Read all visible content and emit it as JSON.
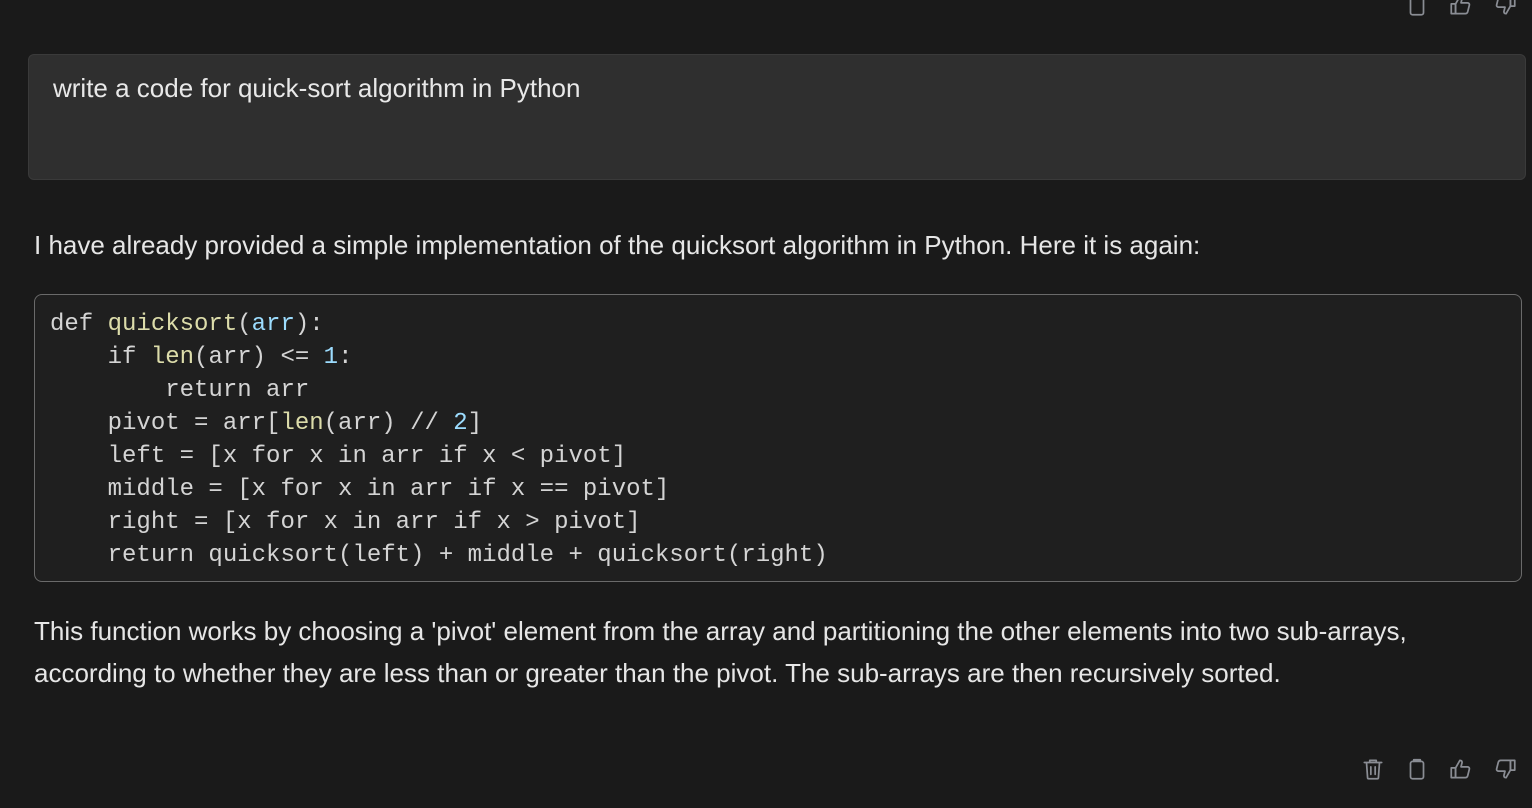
{
  "top_actions": [
    "clipboard-icon",
    "thumbs-up-icon",
    "thumbs-down-icon"
  ],
  "user_message": "write a code for quick-sort algorithm in Python",
  "assistant": {
    "intro": "I have already provided a simple implementation of the quicksort algorithm in Python. Here it is again:",
    "code_lines": [
      [
        [
          "def ",
          "plain"
        ],
        [
          "quicksort",
          "fn"
        ],
        [
          "(",
          "plain"
        ],
        [
          "arr",
          "var"
        ],
        [
          "):",
          "plain"
        ]
      ],
      [
        [
          "    if ",
          "plain"
        ],
        [
          "len",
          "fn"
        ],
        [
          "(arr) <= ",
          "plain"
        ],
        [
          "1",
          "num"
        ],
        [
          ":",
          "plain"
        ]
      ],
      [
        [
          "        return arr",
          "plain"
        ]
      ],
      [
        [
          "    pivot = arr[",
          "plain"
        ],
        [
          "len",
          "fn"
        ],
        [
          "(arr) // ",
          "plain"
        ],
        [
          "2",
          "num"
        ],
        [
          "]",
          "plain"
        ]
      ],
      [
        [
          "    left = [x for x in arr if x < pivot]",
          "plain"
        ]
      ],
      [
        [
          "    middle = [x for x in arr if x == pivot]",
          "plain"
        ]
      ],
      [
        [
          "    right = [x for x in arr if x > pivot]",
          "plain"
        ]
      ],
      [
        [
          "    return quicksort(left) + middle + quicksort(right)",
          "plain"
        ]
      ]
    ],
    "explanation": "This function works by choosing a 'pivot' element from the array and partitioning the other elements into two sub-arrays, according to whether they are less than or greater than the pivot. The sub-arrays are then recursively sorted."
  },
  "bottom_actions": [
    "trash-icon",
    "clipboard-icon",
    "thumbs-up-icon",
    "thumbs-down-icon"
  ]
}
